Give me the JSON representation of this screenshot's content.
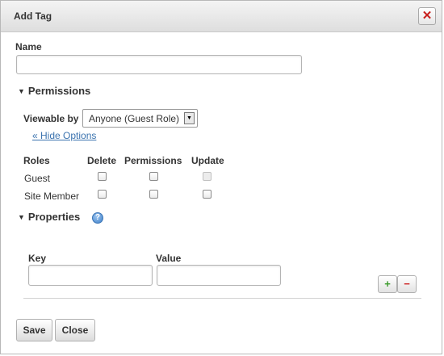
{
  "dialog": {
    "title": "Add Tag",
    "close_icon": "close-x-icon"
  },
  "name": {
    "label": "Name",
    "value": "",
    "placeholder": ""
  },
  "permissions": {
    "heading": "Permissions",
    "viewable_by_label": "Viewable by",
    "viewable_by_value": "Anyone (Guest Role)",
    "hide_options_link": "« Hide Options",
    "columns": [
      "Roles",
      "Delete",
      "Permissions",
      "Update"
    ],
    "rows": [
      {
        "role": "Guest",
        "delete": false,
        "permissions": false,
        "update": false,
        "update_disabled": true
      },
      {
        "role": "Site Member",
        "delete": false,
        "permissions": false,
        "update": false,
        "update_disabled": false
      }
    ]
  },
  "properties": {
    "heading": "Properties",
    "help_icon": "help-icon",
    "key_label": "Key",
    "value_label": "Value",
    "key_value": "",
    "value_value": "",
    "add_symbol": "+",
    "remove_symbol": "−",
    "add_color": "#3a9a2a",
    "remove_color": "#cc2222"
  },
  "actions": {
    "save": "Save",
    "close": "Close"
  }
}
